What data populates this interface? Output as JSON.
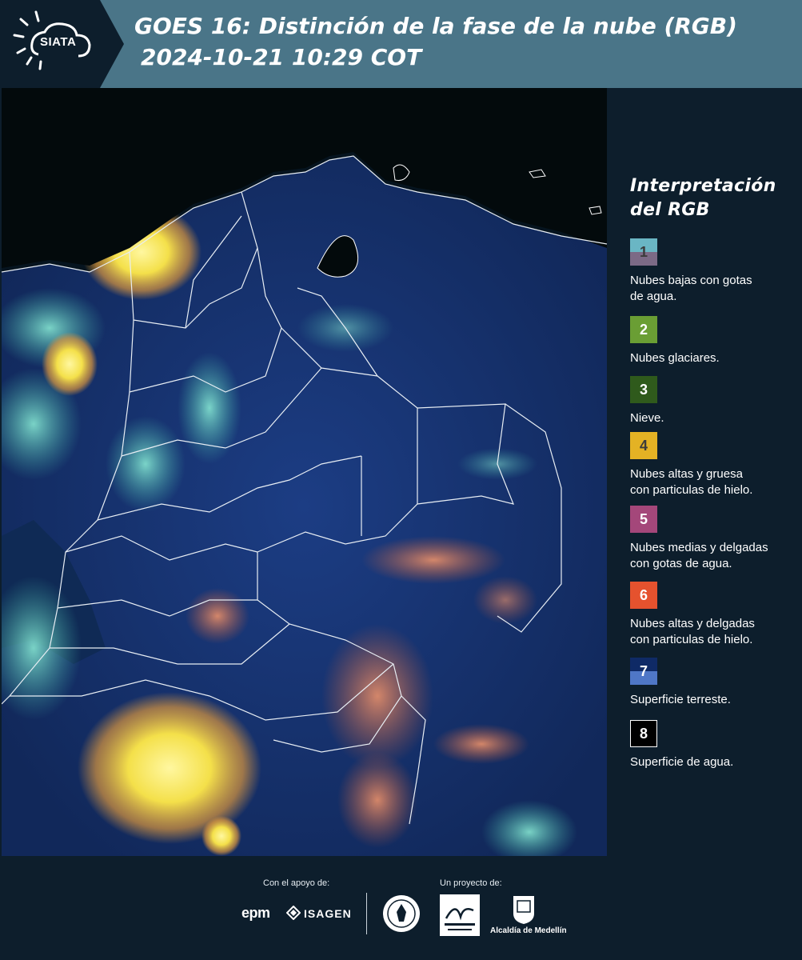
{
  "header": {
    "logo_text": "SIATA",
    "title_line1": "GOES 16: Distinción de la fase de la nube (RGB)",
    "title_line2": "2024-10-21 10:29 COT"
  },
  "map": {
    "product": "RGB",
    "colors": {
      "water": "#071a2e",
      "land": "#16336b",
      "cloud_yellow": "#f4e04a",
      "cloud_cyan": "#5fd9c4",
      "cloud_orange": "#d77a4a",
      "border": "#ffffff"
    }
  },
  "legend": {
    "title_line1": "Interpretación",
    "title_line2": "del RGB",
    "items": [
      {
        "number": "1",
        "label_lines": [
          "Nubes bajas con gotas",
          "de agua."
        ],
        "color_top": "#6ab6c4",
        "color_bottom": "#7c6a86",
        "num_color": "#3b3b3b"
      },
      {
        "number": "2",
        "label_lines": [
          "Nubes glaciares."
        ],
        "color_top": "#6a9e34",
        "color_bottom": "#6a9e34",
        "num_color": "#ffffff"
      },
      {
        "number": "3",
        "label_lines": [
          "Nieve."
        ],
        "color_top": "#2f5a1c",
        "color_bottom": "#2f5a1c",
        "num_color": "#ffffff"
      },
      {
        "number": "4",
        "label_lines": [
          "Nubes altas y gruesa",
          "con particulas de hielo."
        ],
        "color_top": "#e4b224",
        "color_bottom": "#e4b224",
        "num_color": "#3b3b3b"
      },
      {
        "number": "5",
        "label_lines": [
          "Nubes medias y delgadas",
          "con gotas de agua."
        ],
        "color_top": "#a4477a",
        "color_bottom": "#a4477a",
        "num_color": "#ffffff"
      },
      {
        "number": "6",
        "label_lines": [
          "Nubes altas y delgadas",
          "con particulas de hielo."
        ],
        "color_top": "#e5522e",
        "color_bottom": "#e5522e",
        "num_color": "#ffffff"
      },
      {
        "number": "7",
        "label_lines": [
          "Superficie terreste."
        ],
        "color_top": "#0f2a66",
        "color_bottom": "#4f77c7",
        "num_color": "#ffffff"
      },
      {
        "number": "8",
        "label_lines": [
          "Superficie de agua."
        ],
        "color_top": "#000000",
        "color_bottom": "#000000",
        "num_color": "#ffffff"
      }
    ]
  },
  "footer": {
    "support_caption": "Con el apoyo de:",
    "project_caption": "Un proyecto de:",
    "sponsor_epm": "epm",
    "sponsor_isagen": "ISAGEN",
    "partner_alcaldia": "Alcaldía de Medellín"
  }
}
